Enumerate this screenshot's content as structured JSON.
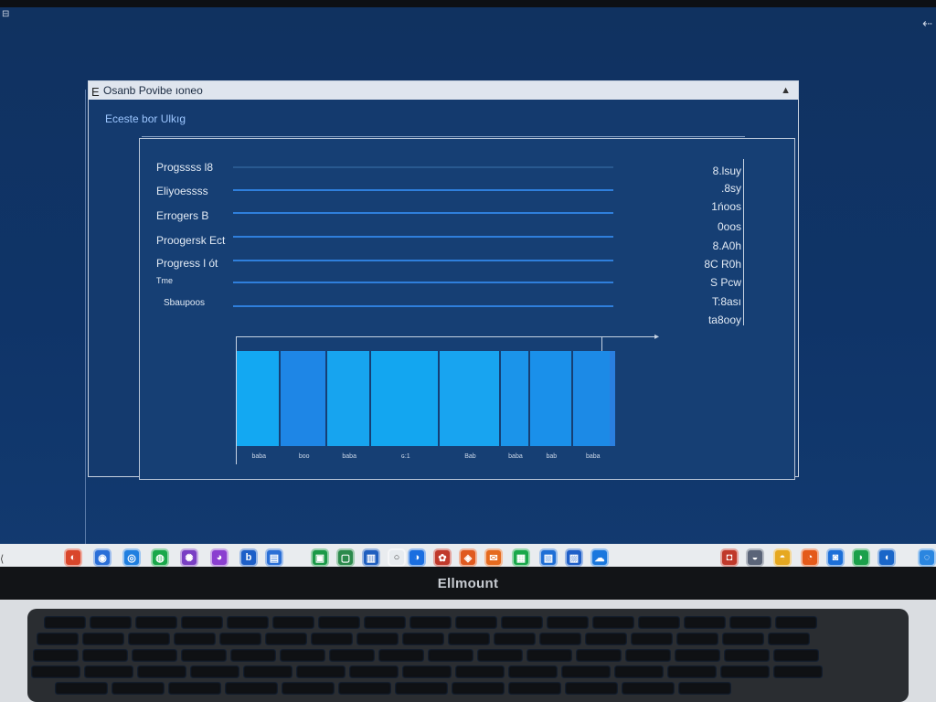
{
  "screen": {
    "corner_glyph": "⊟",
    "corner_right_glyph": "⇠"
  },
  "window": {
    "title_icon": "E",
    "title": "Osanb  Povibe ıoneo",
    "control": "▲",
    "subheader": "Eceste bor Ulkıg"
  },
  "rows": [
    {
      "label": "Progssss l8",
      "value": "8.lsuy"
    },
    {
      "label": "Eliyoessss",
      "value": ".8sy"
    },
    {
      "label": "Errogers B",
      "value": "1ńoos"
    },
    {
      "label": "Proogersk Ect",
      "value": "0oos"
    },
    {
      "label": "Progress l ót",
      "value": "8.A0h"
    },
    {
      "label": "Tme",
      "value": "8C R0h"
    },
    {
      "label": "Sbaupoos",
      "value": "S Pcw"
    }
  ],
  "extra_values": [
    "T:8ası",
    "ta8ooy"
  ],
  "chart_data": {
    "type": "bar",
    "categories": [
      "baba",
      "boo",
      "baba",
      "ɢ:1",
      "Bab",
      "baba",
      "bab",
      "baba"
    ],
    "values": [
      1,
      1,
      1,
      1,
      1,
      1,
      1,
      1
    ],
    "colors": [
      "#13a8f2",
      "#1e86e6",
      "#17a4ef",
      "#13a6f0",
      "#18a4f0",
      "#1b94ea",
      "#1a90ea",
      "#1c8ae6"
    ],
    "ylim": [
      0,
      1
    ]
  },
  "taskbar": {
    "left_glyph": "⟨",
    "icons": [
      {
        "name": "photos-app",
        "glyph": "◐",
        "color": "#d9462b"
      },
      {
        "name": "messages-app",
        "glyph": "◉",
        "color": "#2b6fd8"
      },
      {
        "name": "browser-app",
        "glyph": "◎",
        "color": "#1f7fe0"
      },
      {
        "name": "chat-app",
        "glyph": "◍",
        "color": "#1aa84a"
      },
      {
        "name": "settings-app",
        "glyph": "✺",
        "color": "#7a3fc4"
      },
      {
        "name": "purple-app",
        "glyph": "◕",
        "color": "#8b3fd0"
      },
      {
        "name": "b-app",
        "glyph": "b",
        "color": "#1d5fc8"
      },
      {
        "name": "folder-app",
        "glyph": "▤",
        "color": "#2a6fd6"
      },
      {
        "name": "sheets-app",
        "glyph": "▣",
        "color": "#1c9a48"
      },
      {
        "name": "doc-app",
        "glyph": "▢",
        "color": "#2c8a4c"
      },
      {
        "name": "notes-app",
        "glyph": "▥",
        "color": "#1f5fbf"
      },
      {
        "name": "circle-app",
        "glyph": "○",
        "color": "#e8ecf0"
      },
      {
        "name": "safari-app",
        "glyph": "◑",
        "color": "#1a6ee0"
      },
      {
        "name": "media-app",
        "glyph": "✿",
        "color": "#c0392b"
      },
      {
        "name": "orange-app",
        "glyph": "◈",
        "color": "#e05a20"
      },
      {
        "name": "mail-app",
        "glyph": "✉",
        "color": "#e56a1f"
      },
      {
        "name": "green-app",
        "glyph": "▦",
        "color": "#1aa84a"
      },
      {
        "name": "store-app",
        "glyph": "▧",
        "color": "#1f6fd6"
      },
      {
        "name": "drive-app",
        "glyph": "▨",
        "color": "#1f5fc8"
      },
      {
        "name": "cloud-app",
        "glyph": "☁",
        "color": "#1a78de"
      },
      {
        "name": "tool-app",
        "glyph": "◘",
        "color": "#c0392b"
      },
      {
        "name": "grey-app",
        "glyph": "◒",
        "color": "#5a6478"
      },
      {
        "name": "yellow-app",
        "glyph": "◓",
        "color": "#e6a820"
      },
      {
        "name": "firefox-app",
        "glyph": "◔",
        "color": "#e45a1a"
      },
      {
        "name": "blue-app",
        "glyph": "◙",
        "color": "#1c6fd8"
      },
      {
        "name": "green2-app",
        "glyph": "◗",
        "color": "#1ba04a"
      },
      {
        "name": "globe-app",
        "glyph": "◖",
        "color": "#1a66c8"
      },
      {
        "name": "chat2-app",
        "glyph": "◌",
        "color": "#2a86e0"
      }
    ]
  },
  "brand": "Ellmount"
}
